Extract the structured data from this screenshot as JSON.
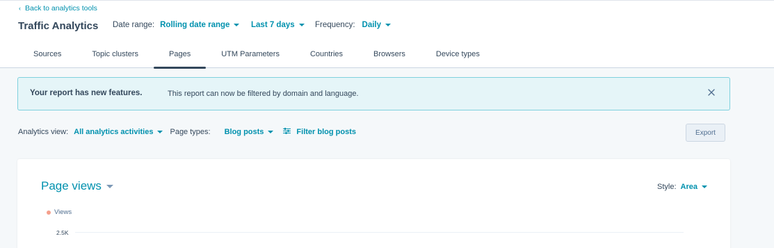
{
  "header": {
    "back_link": "Back to analytics tools",
    "title": "Traffic Analytics",
    "date_range_label": "Date range:",
    "date_range_value": "Rolling date range",
    "period_value": "Last 7 days",
    "frequency_label": "Frequency:",
    "frequency_value": "Daily"
  },
  "tabs": [
    {
      "label": "Sources",
      "active": false
    },
    {
      "label": "Topic clusters",
      "active": false
    },
    {
      "label": "Pages",
      "active": true
    },
    {
      "label": "UTM Parameters",
      "active": false
    },
    {
      "label": "Countries",
      "active": false
    },
    {
      "label": "Browsers",
      "active": false
    },
    {
      "label": "Device types",
      "active": false
    }
  ],
  "banner": {
    "title": "Your report has new features.",
    "text": "This report can now be filtered by domain and language.",
    "close_icon": "close-icon"
  },
  "toolbar": {
    "analytics_view_label": "Analytics view:",
    "analytics_view_value": "All analytics activities",
    "page_types_label": "Page types:",
    "page_types_value": "Blog posts",
    "filter_label": "Filter blog posts",
    "filter_icon": "sliders-icon",
    "export_label": "Export"
  },
  "card": {
    "title": "Page views",
    "style_label": "Style:",
    "style_value": "Area"
  },
  "chart_data": {
    "type": "area",
    "series": [
      {
        "name": "Views",
        "color": "#f5a08c",
        "values": []
      }
    ],
    "ytick_labels": [
      "2.5K"
    ]
  },
  "colors": {
    "accent": "#0091ae",
    "text": "#33475b",
    "banner_bg": "#e5f5f8",
    "banner_border": "#7fd1de",
    "page_bg": "#f5f8fa"
  }
}
